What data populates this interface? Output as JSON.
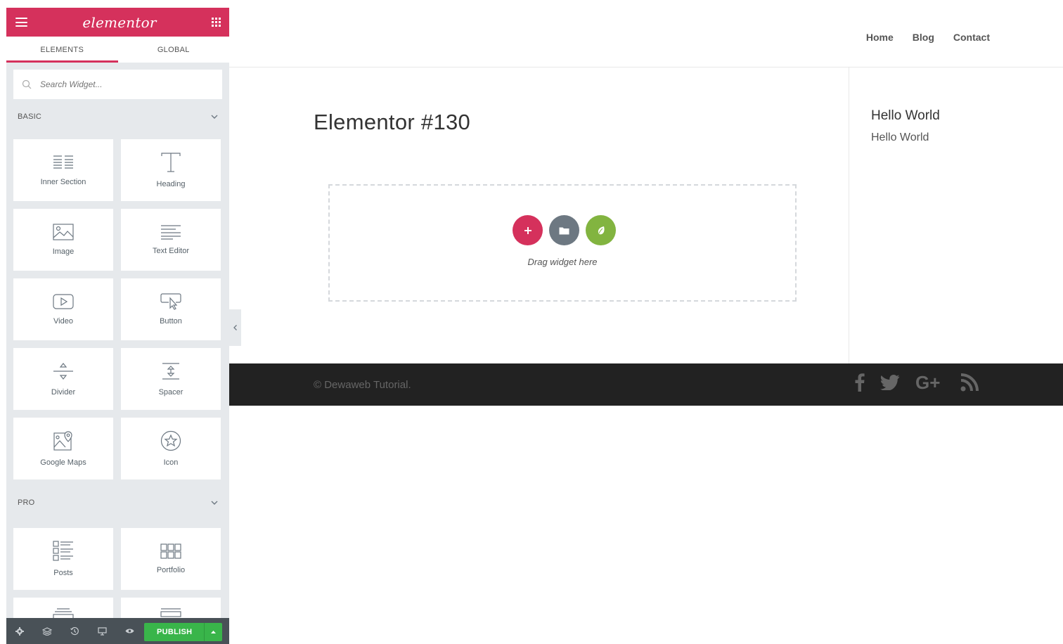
{
  "panel": {
    "logo": "elementor",
    "tabs": [
      {
        "label": "ELEMENTS"
      },
      {
        "label": "GLOBAL"
      }
    ],
    "search_placeholder": "Search Widget...",
    "basic": {
      "title": "BASIC",
      "widgets": [
        {
          "label": "Inner Section",
          "icon": "inner-section-icon"
        },
        {
          "label": "Heading",
          "icon": "heading-icon"
        },
        {
          "label": "Image",
          "icon": "image-icon"
        },
        {
          "label": "Text Editor",
          "icon": "text-editor-icon"
        },
        {
          "label": "Video",
          "icon": "video-icon"
        },
        {
          "label": "Button",
          "icon": "button-icon"
        },
        {
          "label": "Divider",
          "icon": "divider-icon"
        },
        {
          "label": "Spacer",
          "icon": "spacer-icon"
        },
        {
          "label": "Google Maps",
          "icon": "google-maps-icon"
        },
        {
          "label": "Icon",
          "icon": "star-icon"
        }
      ]
    },
    "pro": {
      "title": "PRO",
      "widgets": [
        {
          "label": "Posts",
          "icon": "posts-icon"
        },
        {
          "label": "Portfolio",
          "icon": "portfolio-icon"
        }
      ]
    },
    "footer": {
      "publish_label": "PUBLISH"
    },
    "colors": {
      "brand": "#d5315c",
      "panel_bg": "#e6e9ec",
      "footer_bg": "#495157",
      "publish": "#39b54a"
    }
  },
  "preview": {
    "nav": [
      "Home",
      "Blog",
      "Contact"
    ],
    "page_title": "Elementor #130",
    "dropzone_text": "Drag widget here",
    "sidebar": {
      "widget_title": "Hello World",
      "widget_link": "Hello World"
    },
    "footer": {
      "copyright": "© Dewaweb Tutorial.",
      "social": [
        "facebook-icon",
        "twitter-icon",
        "google-plus-icon",
        "rss-icon"
      ]
    },
    "colors": {
      "add": "#d5315c",
      "template": "#6d7882",
      "envato": "#82b440",
      "footer_bg": "#222222"
    }
  }
}
